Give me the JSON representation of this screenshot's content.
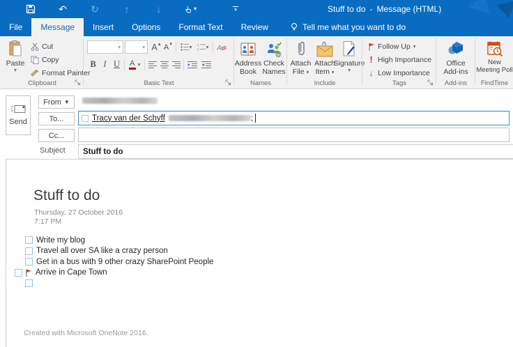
{
  "titlebar": {
    "doc_title": "Stuff to do",
    "separator": "-",
    "app_title": "Message (HTML)"
  },
  "tabs": [
    {
      "label": "File"
    },
    {
      "label": "Message",
      "active": true
    },
    {
      "label": "Insert"
    },
    {
      "label": "Options"
    },
    {
      "label": "Format Text"
    },
    {
      "label": "Review"
    }
  ],
  "tell_me": {
    "label": "Tell me what you want to do"
  },
  "ribbon": {
    "clipboard": {
      "label": "Clipboard",
      "paste": "Paste",
      "cut": "Cut",
      "copy": "Copy",
      "format_painter": "Format Painter"
    },
    "basic_text": {
      "label": "Basic Text",
      "bold": "B",
      "italic": "I",
      "underline": "U",
      "font_color": "A",
      "grow_font": "A",
      "shrink_font": "A"
    },
    "names": {
      "label": "Names",
      "address_book": "Address Book",
      "check_names": "Check Names"
    },
    "include": {
      "label": "Include",
      "attach_file": "Attach File",
      "attach_item": "Attach Item",
      "signature": "Signature"
    },
    "tags": {
      "label": "Tags",
      "follow_up": "Follow Up",
      "high_importance": "High Importance",
      "low_importance": "Low Importance"
    },
    "addins": {
      "label": "Add-ins",
      "office_addins": "Office Add-ins"
    },
    "findtime": {
      "label": "FindTime",
      "new_meeting_poll": "New Meeting Poll"
    }
  },
  "compose": {
    "send_label": "Send",
    "from_label": "From",
    "to_label": "To...",
    "cc_label": "Cc...",
    "subject_label": "Subject",
    "subject_value": "Stuff to do",
    "to_recipient_name": "Tracy van der Schyff",
    "to_recipient_suffix": ";"
  },
  "note": {
    "title": "Stuff to do",
    "date": "Thursday, 27 October 2016",
    "time": "7:17 PM",
    "todos": [
      {
        "text": "Write my blog",
        "flagged": false
      },
      {
        "text": "Travel all over SA like a crazy person",
        "flagged": false
      },
      {
        "text": "Get in a bus with 9 other crazy SharePoint People",
        "flagged": false
      },
      {
        "text": "Arrive in Cape Town",
        "flagged": true
      },
      {
        "text": "",
        "flagged": false
      }
    ],
    "footer": "Created with Microsoft OneNote 2016."
  },
  "colors": {
    "titlebar_blue": "#0a6cc0",
    "ribbon_bg": "#f1f1f1",
    "focused_field_border": "#3f8ed6",
    "checkbox_border": "#9dc3e6",
    "flag": "#c8401f",
    "high_importance": "#c8401f",
    "low_importance": "#2b6cb0",
    "attach_item_envelope": "#f2c572",
    "findtime_orange": "#d24a0f",
    "addins_blue": "#1464b4"
  }
}
